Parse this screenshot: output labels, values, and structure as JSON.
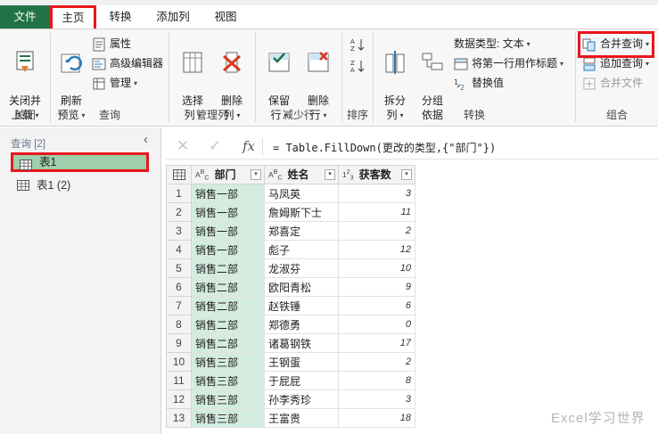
{
  "tabs": {
    "file": "文件",
    "home": "主页",
    "transform": "转换",
    "add_column": "添加列",
    "view": "视图"
  },
  "ribbon": {
    "close": {
      "btn": "关闭并\n上载",
      "label": "关闭"
    },
    "query": {
      "refresh": "刷新\n预览",
      "properties": "属性",
      "advanced_editor": "高级编辑器",
      "manage": "管理",
      "label": "查询"
    },
    "manage_cols": {
      "choose": "选择\n列",
      "remove": "删除\n列",
      "label": "管理列"
    },
    "reduce_rows": {
      "keep": "保留\n行",
      "remove": "删除\n行",
      "label": "减少行"
    },
    "sort": {
      "label": "排序"
    },
    "transform": {
      "split": "拆分\n列",
      "group": "分组\n依据",
      "data_type": "数据类型: 文本",
      "first_row_header": "将第一行用作标题",
      "replace": "替换值",
      "label": "转换"
    },
    "combine": {
      "merge": "合并查询",
      "append": "追加查询",
      "combine_files": "合并文件",
      "label": "组合"
    }
  },
  "queries": {
    "header": "查询 [2]",
    "items": [
      "表1",
      "表1 (2)"
    ]
  },
  "formula": "= Table.FillDown(更改的类型,{\"部门\"})",
  "grid": {
    "columns": [
      {
        "type": "ABC",
        "name": "部门"
      },
      {
        "type": "ABC",
        "name": "姓名"
      },
      {
        "type": "123",
        "name": "获客数"
      }
    ],
    "rows": [
      [
        "1",
        "销售一部",
        "马凤英",
        "3"
      ],
      [
        "2",
        "销售一部",
        "詹姆斯下士",
        "11"
      ],
      [
        "3",
        "销售一部",
        "郑喜定",
        "2"
      ],
      [
        "4",
        "销售一部",
        "彪子",
        "12"
      ],
      [
        "5",
        "销售二部",
        "龙淑芬",
        "10"
      ],
      [
        "6",
        "销售二部",
        "欧阳青松",
        "9"
      ],
      [
        "7",
        "销售二部",
        "赵铁锤",
        "6"
      ],
      [
        "8",
        "销售二部",
        "郑德勇",
        "0"
      ],
      [
        "9",
        "销售二部",
        "诸葛钢铁",
        "17"
      ],
      [
        "10",
        "销售三部",
        "王钢蛋",
        "2"
      ],
      [
        "11",
        "销售三部",
        "于屁屁",
        "8"
      ],
      [
        "12",
        "销售三部",
        "孙李秀珍",
        "3"
      ],
      [
        "13",
        "销售三部",
        "王富贵",
        "18"
      ]
    ]
  },
  "watermark": "Excel学习世界",
  "colors": {
    "file_tab": "#217346",
    "highlight_red": "#e8161c",
    "selected_query": "#9ed0ab",
    "filled_column": "#d4ece0"
  }
}
